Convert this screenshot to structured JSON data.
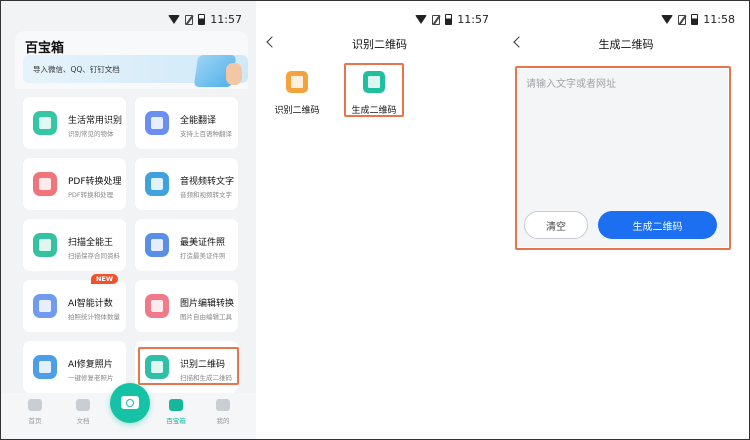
{
  "status_bar": [
    {
      "time": "11:57"
    },
    {
      "time": "11:57"
    },
    {
      "time": "11:58"
    }
  ],
  "home": {
    "app_title": "百宝箱",
    "banner_text": "导入微信、QQ、钉钉文档",
    "tiles": [
      {
        "title": "生活常用识别",
        "subtitle": "识别常见的物体",
        "color": "#35c7a4"
      },
      {
        "title": "全能翻译",
        "subtitle": "支持上百语种翻译",
        "color": "#6a8ff0"
      },
      {
        "title": "PDF转换处理",
        "subtitle": "PDF转换和处理",
        "color": "#f0747a"
      },
      {
        "title": "音视频转文字",
        "subtitle": "音频和视频转文字",
        "color": "#3fa2dd"
      },
      {
        "title": "扫描全能王",
        "subtitle": "扫描保存合同资料",
        "color": "#36c2a0"
      },
      {
        "title": "最美证件照",
        "subtitle": "打造最美证件照",
        "color": "#5a8fe8"
      },
      {
        "title": "AI智能计数",
        "subtitle": "拍照统计物体数量",
        "color": "#6f9cee",
        "badge": "NEW"
      },
      {
        "title": "图片编辑转换",
        "subtitle": "图片自由编辑工具",
        "color": "#ef7b8a"
      },
      {
        "title": "AI修复照片",
        "subtitle": "一键修复老照片",
        "color": "#4c9fe6"
      },
      {
        "title": "识别二维码",
        "subtitle": "扫描和生成二维码",
        "color": "#2fbfa6"
      }
    ],
    "nav": [
      {
        "label": "首页"
      },
      {
        "label": "文档"
      },
      {
        "label": "百宝箱"
      },
      {
        "label": "我的"
      }
    ]
  },
  "qr_menu": {
    "title": "识别二维码",
    "items": [
      {
        "label": "识别二维码",
        "color": "#f4a23b"
      },
      {
        "label": "生成二维码",
        "color": "#1fc0a0"
      }
    ]
  },
  "qr_generate": {
    "title": "生成二维码",
    "placeholder": "请输入文字或者网址",
    "value": "",
    "clear_label": "清空",
    "generate_label": "生成二维码"
  },
  "colors": {
    "accent": "#16b79a",
    "primary_button": "#1c6ff0",
    "highlight": "#e8744e"
  }
}
